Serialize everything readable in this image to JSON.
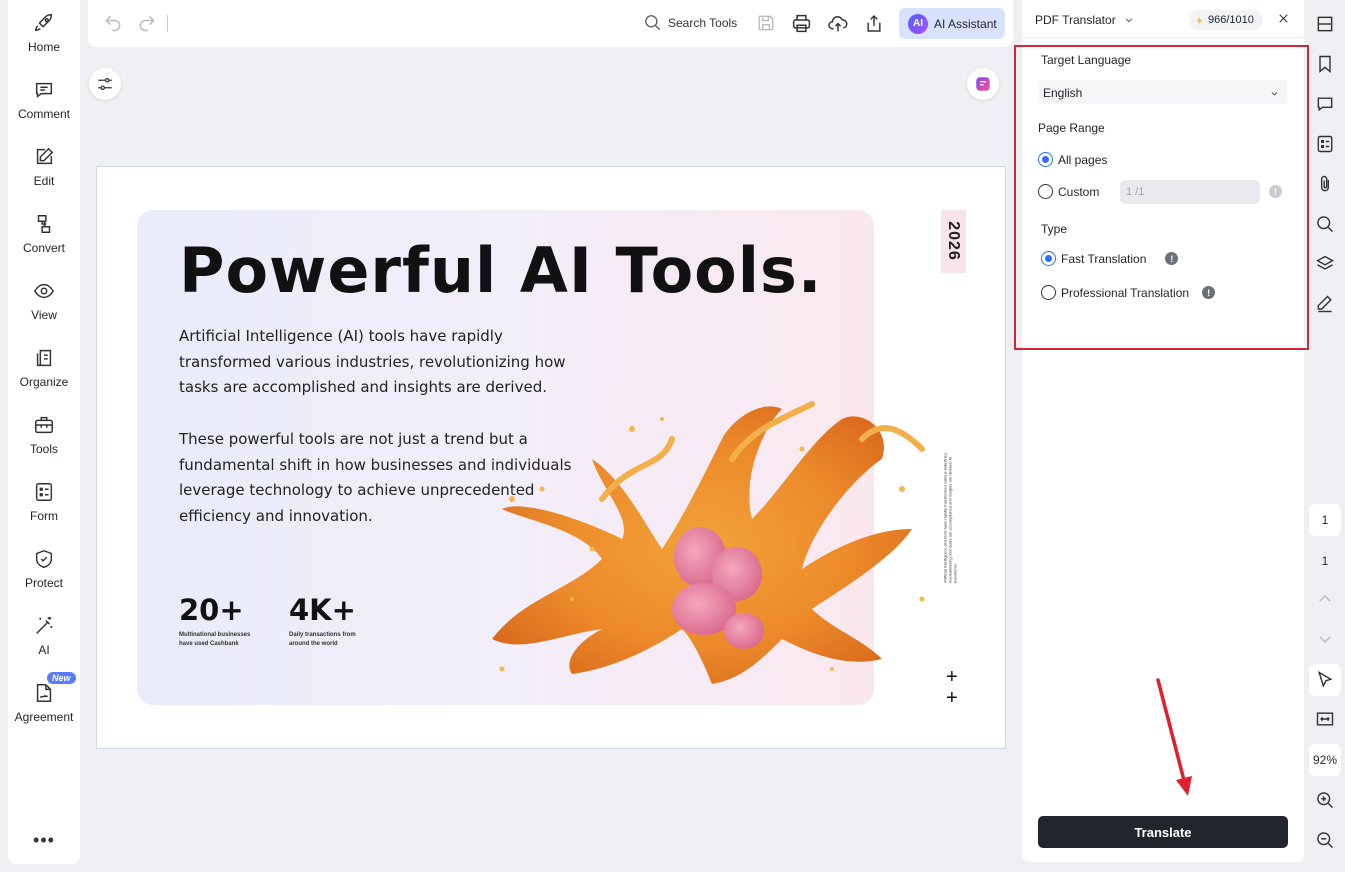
{
  "nav": [
    {
      "label": "Home",
      "icon": "rocket-icon"
    },
    {
      "label": "Comment",
      "icon": "comment-icon"
    },
    {
      "label": "Edit",
      "icon": "edit-icon"
    },
    {
      "label": "Convert",
      "icon": "convert-icon"
    },
    {
      "label": "View",
      "icon": "view-icon"
    },
    {
      "label": "Organize",
      "icon": "organize-icon"
    },
    {
      "label": "Tools",
      "icon": "toolbox-icon"
    },
    {
      "label": "Form",
      "icon": "form-icon"
    },
    {
      "label": "Protect",
      "icon": "shield-icon"
    },
    {
      "label": "AI",
      "icon": "magic-wand-icon"
    },
    {
      "label": "Agreement",
      "icon": "agreement-icon",
      "badge": "New"
    }
  ],
  "nav_more": "•••",
  "toolbar": {
    "search_label": "Search Tools",
    "ai_logo": "AI",
    "ai_label": "AI Assistant"
  },
  "document": {
    "title": "Powerful AI Tools.",
    "para1": "Artificial Intelligence (AI) tools have rapidly transformed various industries, revolutionizing how tasks are accomplished and insights are derived.",
    "para2": "These powerful tools are not just a trend but a fundamental shift in how businesses and individuals leverage technology to achieve unprecedented efficiency and innovation.",
    "stats": [
      {
        "value": "20+",
        "caption": "Multinational businesses have used Cashbank"
      },
      {
        "value": "4K+",
        "caption": "Daily transactions from around the world"
      }
    ],
    "year": "2026",
    "side_text": "Artificial Intelligence (AI) tools have rapidly transformed various industries, revolutionizing how tasks are accomplished and insights are derived. AI transforms",
    "plus1": "+",
    "plus2": "+"
  },
  "panel": {
    "title": "PDF Translator",
    "credits": "966/1010",
    "target_language_label": "Target Language",
    "target_language_value": "English",
    "page_range_label": "Page Range",
    "all_pages_label": "All pages",
    "custom_label": "Custom",
    "custom_range_placeholder": "1 /1",
    "type_label": "Type",
    "fast_label": "Fast Translation",
    "pro_label": "Professional Translation",
    "translate_label": "Translate",
    "selected_range": "All pages",
    "selected_type": "Fast Translation"
  },
  "rail": {
    "current_page": "1",
    "total_pages": "1",
    "zoom": "92%"
  },
  "colors": {
    "accent": "#2f6bff",
    "highlight_box": "#d0283a",
    "annotation_arrow": "#e0202e",
    "translate_button": "#23252d"
  }
}
